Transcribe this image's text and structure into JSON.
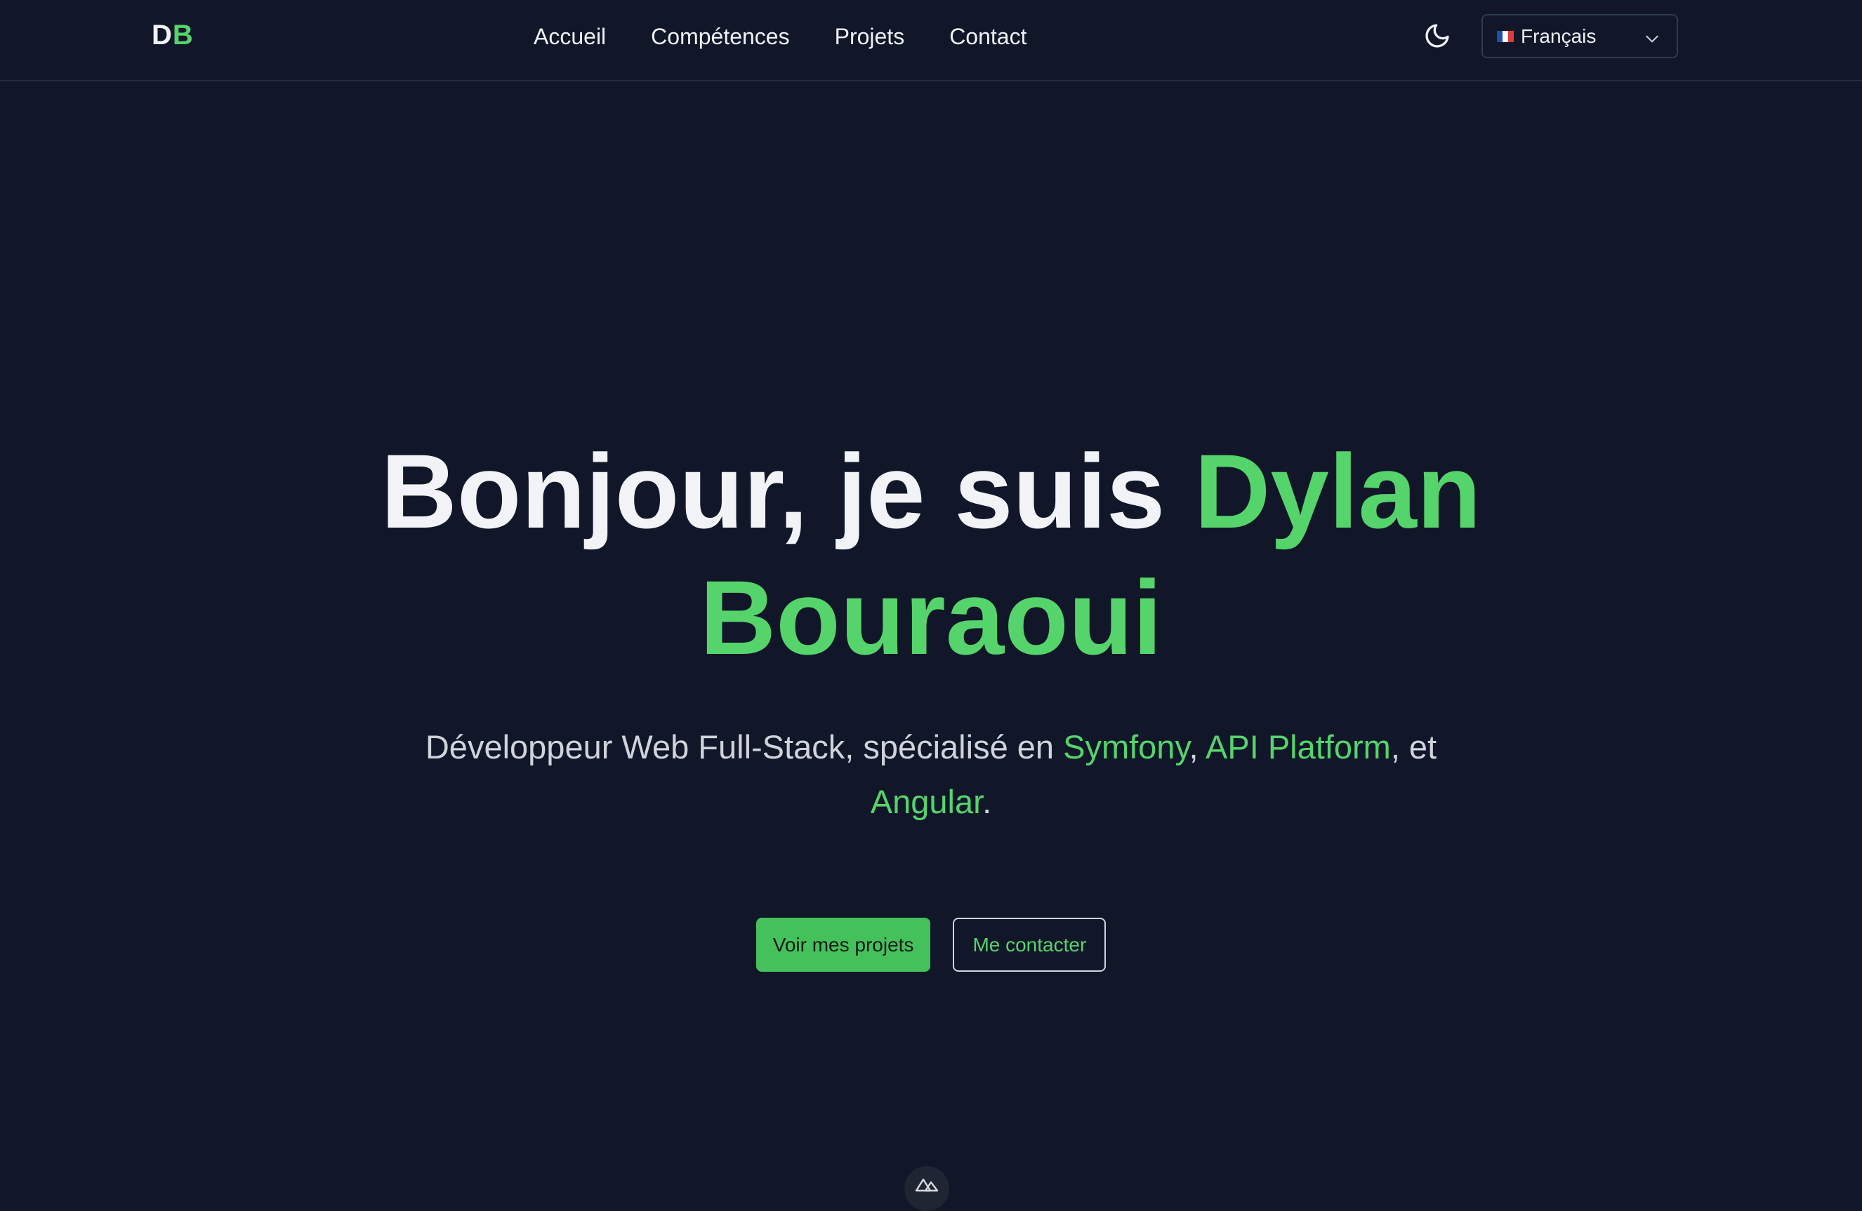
{
  "header": {
    "logo": {
      "d": "D",
      "b": "B"
    },
    "nav": [
      "Accueil",
      "Compétences",
      "Projets",
      "Contact"
    ],
    "language": {
      "selected": "Français",
      "flag_colors": [
        "#1f4fa8",
        "#ffffff",
        "#e23b3b"
      ]
    }
  },
  "hero": {
    "title_prefix": "Bonjour, je suis ",
    "title_name_first": "Dylan",
    "title_name_last": "Bouraoui",
    "subtitle_prefix": "Développeur Web Full-Stack, spécialisé en ",
    "subtitle_tech1": "Symfony",
    "subtitle_sep1": ", ",
    "subtitle_tech2": "API Platform",
    "subtitle_sep2": ", et ",
    "subtitle_tech3": "Angular",
    "subtitle_end": ".",
    "primary_button": "Voir mes projets",
    "secondary_button": "Me contacter"
  },
  "colors": {
    "background": "#111729",
    "accent": "#55d46c"
  },
  "icons": {
    "theme_toggle": "moon-icon",
    "dropdown": "chevron-down-icon",
    "badge": "nuxt-logo-icon"
  }
}
